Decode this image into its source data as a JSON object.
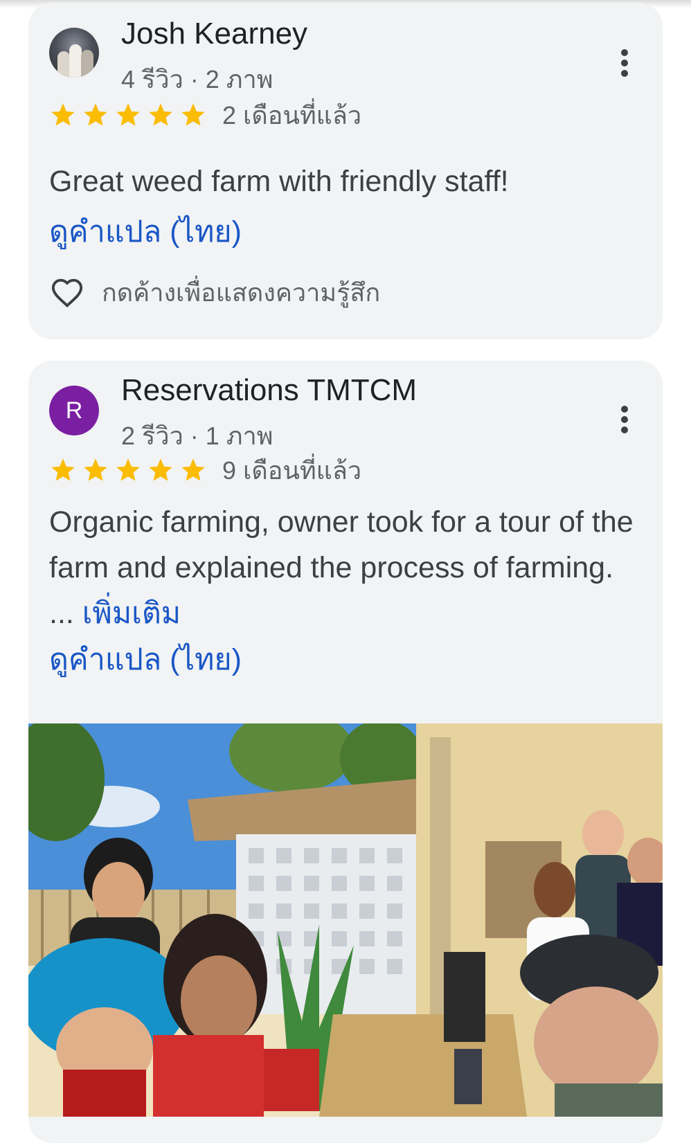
{
  "reviews": [
    {
      "author": "Josh Kearney",
      "meta": "4 รีวิว · 2 ภาพ",
      "rating": 5,
      "date": "2 เดือนที่แล้ว",
      "text": "Great weed farm with friendly staff!",
      "translate_label": "ดูคำแปล (ไทย)",
      "react_label": "กดค้างเพื่อแสดงความรู้สึก"
    },
    {
      "author": "Reservations TMTCM",
      "avatar_letter": "R",
      "avatar_color": "#7b1fa2",
      "meta": "2 รีวิว · 1 ภาพ",
      "rating": 5,
      "date": "9 เดือนที่แล้ว",
      "text": "Organic farming, owner took for a tour of the farm and explained the process of farming. ...",
      "more_label": "เพิ่มเติม",
      "translate_label": "ดูคำแปล (ไทย)"
    }
  ],
  "colors": {
    "card_bg": "#f1f3f4",
    "star": "#fbbc04",
    "link": "#1a57c6"
  },
  "icons": [
    "more-vert-icon",
    "star-icon",
    "heart-outline-icon"
  ]
}
